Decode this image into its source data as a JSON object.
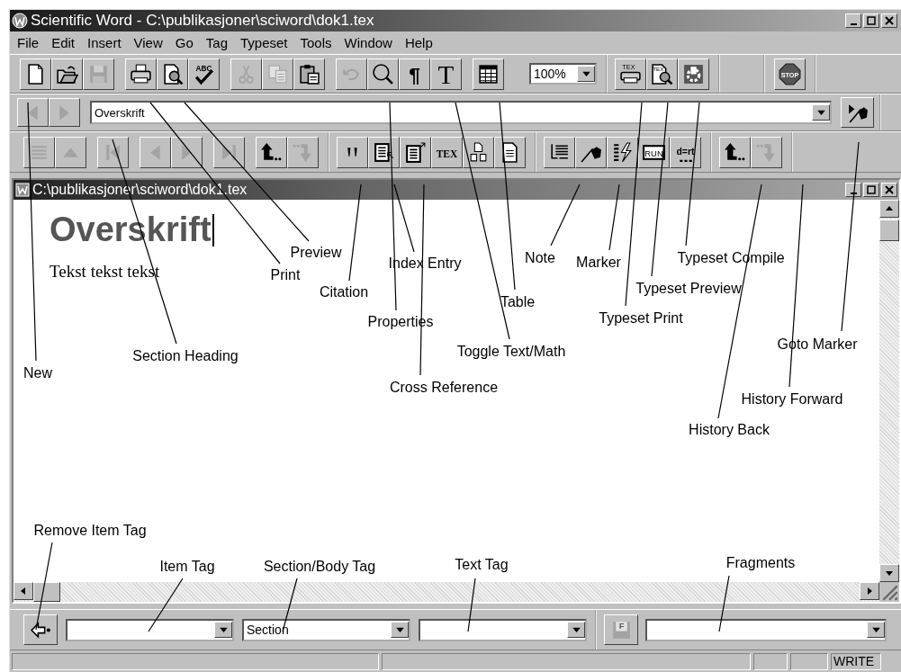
{
  "window": {
    "title": "Scientific Word - C:\\publikasjoner\\sciword\\dok1.tex"
  },
  "menu": [
    "File",
    "Edit",
    "Insert",
    "View",
    "Go",
    "Tag",
    "Typeset",
    "Tools",
    "Window",
    "Help"
  ],
  "standard_toolbar": {
    "bands": [
      {
        "groups": [
          [
            {
              "kind": "new",
              "disabled": false
            },
            {
              "kind": "open",
              "disabled": false
            },
            {
              "kind": "save",
              "disabled": true
            }
          ],
          [
            {
              "kind": "print",
              "disabled": false
            },
            {
              "kind": "preview",
              "disabled": false
            },
            {
              "kind": "spell",
              "disabled": false,
              "glyph": "ABC"
            }
          ],
          [
            {
              "kind": "cut",
              "disabled": true
            },
            {
              "kind": "copy",
              "disabled": true
            },
            {
              "kind": "paste",
              "disabled": false
            }
          ],
          [
            {
              "kind": "undo",
              "disabled": true
            },
            {
              "kind": "find",
              "disabled": false
            },
            {
              "kind": "pilcrow",
              "disabled": false,
              "glyph": "¶"
            },
            {
              "kind": "textmath",
              "disabled": false,
              "glyph": "T"
            }
          ],
          [
            {
              "kind": "table",
              "disabled": false
            }
          ],
          [
            {
              "kind": "zoom",
              "value": "100%"
            }
          ]
        ]
      },
      {
        "groups": [
          [
            {
              "kind": "texprint",
              "disabled": false,
              "glyph": "TEX"
            },
            {
              "kind": "texpreview",
              "disabled": false,
              "glyph": "TEX"
            },
            {
              "kind": "compile",
              "disabled": false
            }
          ]
        ]
      },
      {
        "groups": [
          [
            {
              "kind": "stop",
              "disabled": false,
              "glyph": "STOP"
            }
          ]
        ]
      }
    ]
  },
  "navigate_toolbar": {
    "back_disabled": true,
    "forward_disabled": true,
    "field": {
      "value": "Overskrift"
    }
  },
  "structure_toolbar": {
    "bands": [
      {
        "groups": [
          [
            {
              "kind": "list",
              "disabled": true
            },
            {
              "kind": "up",
              "disabled": true
            }
          ],
          [
            {
              "kind": "first",
              "disabled": true
            }
          ],
          [
            {
              "kind": "prev",
              "disabled": true
            },
            {
              "kind": "next",
              "disabled": true
            }
          ],
          [
            {
              "kind": "last",
              "disabled": true
            }
          ],
          [
            {
              "kind": "histback",
              "disabled": false
            },
            {
              "kind": "histfwd",
              "disabled": true
            }
          ]
        ]
      },
      {
        "groups": [
          [
            {
              "kind": "citation",
              "disabled": false
            },
            {
              "kind": "index",
              "disabled": false
            },
            {
              "kind": "crossref",
              "disabled": false
            },
            {
              "kind": "toggletex",
              "disabled": false,
              "glyph": "TEX"
            },
            {
              "kind": "shapes",
              "disabled": false
            },
            {
              "kind": "document",
              "disabled": false
            }
          ]
        ]
      },
      {
        "groups": [
          [
            {
              "kind": "note",
              "disabled": false
            },
            {
              "kind": "marker",
              "disabled": false
            },
            {
              "kind": "lightning",
              "disabled": false
            },
            {
              "kind": "run",
              "disabled": false,
              "glyph": "RUN"
            },
            {
              "kind": "dert",
              "disabled": false,
              "glyph": "d=rt"
            }
          ]
        ]
      },
      {
        "groups": [
          [
            {
              "kind": "histback",
              "disabled": false
            },
            {
              "kind": "histfwd",
              "disabled": true
            }
          ]
        ]
      }
    ]
  },
  "document": {
    "title": "C:\\publikasjoner\\sciword\\dok1.tex",
    "heading": "Overskrift",
    "body": "Tekst tekst tekst"
  },
  "tag_toolbar": {
    "section_tag": {
      "value": "Section"
    },
    "fragment_button": {
      "disabled": true,
      "glyph": "F"
    }
  },
  "status_bar": {
    "mode": "WRITE"
  },
  "callouts": [
    {
      "label": "New"
    },
    {
      "label": "Section Heading"
    },
    {
      "label": "Print"
    },
    {
      "label": "Preview"
    },
    {
      "label": "Citation"
    },
    {
      "label": "Index Entry"
    },
    {
      "label": "Properties"
    },
    {
      "label": "Table"
    },
    {
      "label": "Toggle Text/Math"
    },
    {
      "label": "Cross Reference"
    },
    {
      "label": "Note"
    },
    {
      "label": "Marker"
    },
    {
      "label": "Typeset Print"
    },
    {
      "label": "Typeset Preview"
    },
    {
      "label": "Typeset Compile"
    },
    {
      "label": "Goto Marker"
    },
    {
      "label": "History Forward"
    },
    {
      "label": "History Back"
    },
    {
      "label": "Remove Item Tag"
    },
    {
      "label": "Item Tag"
    },
    {
      "label": "Section/Body Tag"
    },
    {
      "label": "Text Tag"
    },
    {
      "label": "Fragments"
    }
  ]
}
